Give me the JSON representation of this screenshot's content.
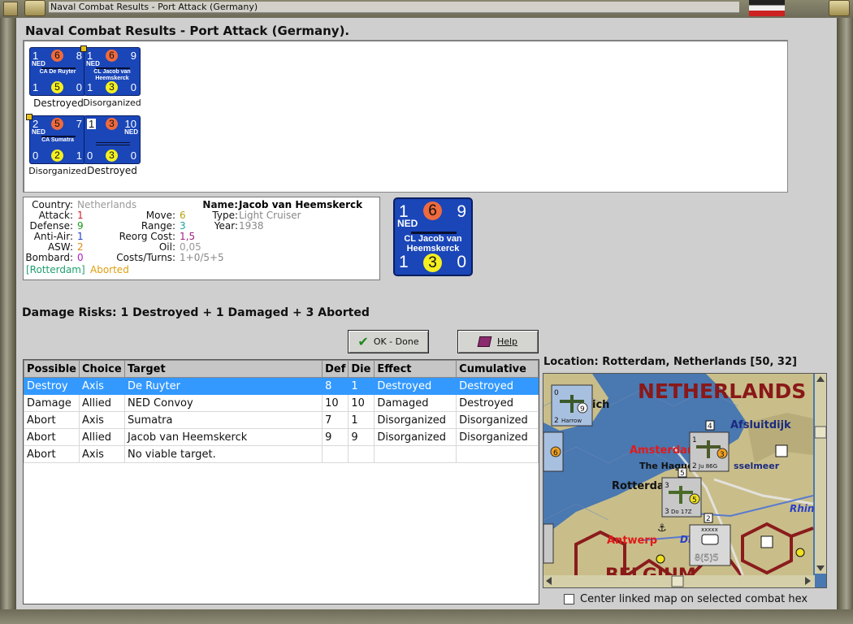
{
  "window": {
    "title": "Naval Combat Results - Port Attack (Germany)"
  },
  "heading": "Naval Combat Results - Port Attack (Germany).",
  "units": [
    {
      "attack": "1",
      "top_dot": "6",
      "move": "8",
      "nation": "NED",
      "name_line1": "CA De Ruyter",
      "name_line2": "",
      "defense": "1",
      "bottom_dot": "5",
      "right": "0",
      "status": "Destroyed"
    },
    {
      "attack": "1",
      "top_dot": "6",
      "move": "9",
      "nation": "NED",
      "name_line1": "CL Jacob van",
      "name_line2": "Heemskerck",
      "defense": "1",
      "bottom_dot": "3",
      "right": "0",
      "status": "Disorganized"
    },
    {
      "attack": "2",
      "top_dot": "5",
      "move": "7",
      "nation": "NED",
      "name_line1": "CA Sumatra",
      "name_line2": "",
      "defense": "0",
      "bottom_dot": "2",
      "right": "1",
      "status": "Disorganized"
    },
    {
      "attack": "1",
      "top_dot": "3",
      "move": "10",
      "nation": "NED",
      "name_line1": "",
      "name_line2": "",
      "defense": "0",
      "bottom_dot": "3",
      "right": "0",
      "status": "Destroyed"
    }
  ],
  "info": {
    "country_label": "Country:",
    "country": "Netherlands",
    "attack_label": "Attack:",
    "attack": "1",
    "defense_label": "Defense:",
    "defense": "9",
    "antiair_label": "Anti-Air:",
    "antiair": "1",
    "asw_label": "ASW:",
    "asw": "2",
    "bombard_label": "Bombard:",
    "bombard": "0",
    "move_label": "Move:",
    "move": "6",
    "range_label": "Range:",
    "range": "3",
    "reorg_label": "Reorg Cost:",
    "reorg": "1,5",
    "oil_label": "Oil:",
    "oil": "0,05",
    "costs_label": "Costs/Turns:",
    "costs": "1+0/5+5",
    "name_label": "Name:",
    "name": "Jacob van Heemskerck",
    "type_label": "Type:",
    "type": "Light Cruiser",
    "year_label": "Year:",
    "year": "1938",
    "location_tag": "[Rotterdam]",
    "result_tag": "Aborted"
  },
  "big_counter": {
    "attack": "1",
    "top_dot": "6",
    "move": "9",
    "nation": "NED",
    "name_line1": "CL Jacob van",
    "name_line2": "Heemskerck",
    "defense": "1",
    "bottom_dot": "3",
    "right": "0"
  },
  "damage_risks": "Damage Risks: 1 Destroyed + 1 Damaged + 3 Aborted",
  "buttons": {
    "ok": "OK - Done",
    "help": "Help"
  },
  "table": {
    "headers": [
      "Possible",
      "Choice",
      "Target",
      "Def",
      "Die",
      "Effect",
      "Cumulative"
    ],
    "rows": [
      [
        "Destroy",
        "Axis",
        "De Ruyter",
        "8",
        "1",
        "Destroyed",
        "Destroyed"
      ],
      [
        "Damage",
        "Allied",
        "NED Convoy",
        "10",
        "10",
        "Damaged",
        "Destroyed"
      ],
      [
        "Abort",
        "Axis",
        "Sumatra",
        "7",
        "1",
        "Disorganized",
        "Disorganized"
      ],
      [
        "Abort",
        "Allied",
        "Jacob van Heemskerck",
        "9",
        "9",
        "Disorganized",
        "Disorganized"
      ],
      [
        "Abort",
        "Axis",
        "No viable target.",
        "",
        "",
        "",
        ""
      ]
    ]
  },
  "location": "Location: Rotterdam, Netherlands [50, 32]",
  "map": {
    "country_top": "NETHERLANDS",
    "country_bottom": "BELGIUM",
    "cities": [
      "Amsterdam",
      "The Hague",
      "Rotterdam",
      "Antwerp"
    ],
    "places": [
      "Afsluitdijk",
      "sselmeer",
      "ich",
      "Rhin",
      "Di"
    ],
    "units": [
      {
        "left": "0",
        "right": "9",
        "bottom_left": "2",
        "name": "Harrow"
      },
      {
        "left": "1",
        "right": "3",
        "bottom_left": "2",
        "name": "Ju 86G"
      },
      {
        "left": "3",
        "right": "5",
        "bottom_left": "3",
        "name": "Do 17Z"
      }
    ],
    "stack_labels": [
      "4",
      "5",
      "2",
      "6"
    ],
    "hq_label": "8(5)5",
    "hq_top": "xxxxx"
  },
  "checkbox": {
    "label": "Center linked map on selected combat hex"
  },
  "colors": {
    "counter_blue": "#1a46b8",
    "selected_row": "#3399ff",
    "map_sea": "#4a78b0",
    "map_land": "#c9be8a"
  }
}
